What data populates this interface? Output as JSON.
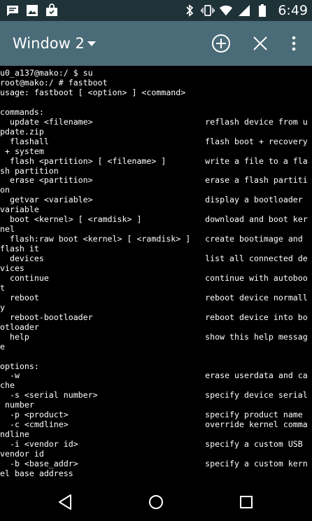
{
  "status_bar": {
    "time": "6:49",
    "left_icons": [
      "chat-icon",
      "image-icon",
      "shopping-bag-icon"
    ],
    "right_icons": [
      "bluetooth-icon",
      "vibrate-icon",
      "wifi-icon",
      "signal-icon",
      "battery-icon"
    ]
  },
  "app_bar": {
    "title": "Window 2",
    "actions": [
      "add-window-icon",
      "close-window-icon",
      "overflow-menu-icon"
    ]
  },
  "terminal": {
    "lines": [
      "u0_a137@mako:/ $ su",
      "root@mako:/ # fastboot",
      "usage: fastboot [ <option> ] <command>",
      "",
      "commands:",
      "  update <filename>                       reflash device from u",
      "pdate.zip",
      "  flashall                                flash boot + recovery",
      " + system",
      "  flash <partition> [ <filename> ]        write a file to a fla",
      "sh partition",
      "  erase <partition>                       erase a flash partiti",
      "on",
      "  getvar <variable>                       display a bootloader",
      "variable",
      "  boot <kernel> [ <ramdisk> ]             download and boot ker",
      "nel",
      "  flash:raw boot <kernel> [ <ramdisk> ]   create bootimage and",
      "flash it",
      "  devices                                 list all connected de",
      "vices",
      "  continue                                continue with autoboo",
      "t",
      "  reboot                                  reboot device normall",
      "y",
      "  reboot-bootloader                       reboot device into bo",
      "otloader",
      "  help                                    show this help messag",
      "e",
      "",
      "options:",
      "  -w                                      erase userdata and ca",
      "che",
      "  -s <serial number>                      specify device serial",
      " number",
      "  -p <product>                            specify product name",
      "  -c <cmdline>                            override kernel comma",
      "ndline",
      "  -i <vendor id>                          specify a custom USB",
      "vendor id",
      "  -b <base_addr>                          specify a custom kern",
      "el base address"
    ]
  },
  "nav_bar": {
    "buttons": [
      "back-icon",
      "home-icon",
      "recents-icon"
    ]
  },
  "colors": {
    "status_bar_bg": "#1f3238",
    "app_bar_bg": "#4a6b78",
    "terminal_bg": "#000000",
    "terminal_fg": "#ffffff"
  }
}
